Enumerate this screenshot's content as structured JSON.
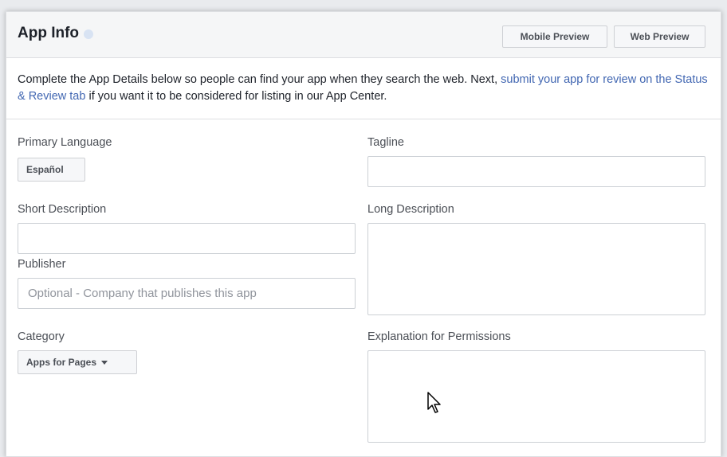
{
  "header": {
    "title": "App Info",
    "mobile_preview_label": "Mobile Preview",
    "web_preview_label": "Web Preview"
  },
  "intro": {
    "text_before": "Complete the App Details below so people can find your app when they search the web. Next, ",
    "link_text": "submit your app for review on the Status & Review tab",
    "text_after": " if you want it to be considered for listing in our App Center."
  },
  "form": {
    "primary_language": {
      "label": "Primary Language",
      "value": "Español"
    },
    "tagline": {
      "label": "Tagline",
      "value": ""
    },
    "short_description": {
      "label": "Short Description",
      "value": ""
    },
    "long_description": {
      "label": "Long Description",
      "value": ""
    },
    "publisher": {
      "label": "Publisher",
      "value": "",
      "placeholder": "Optional - Company that publishes this app"
    },
    "category": {
      "label": "Category",
      "value": "Apps for Pages"
    },
    "permissions_explanation": {
      "label": "Explanation for Permissions",
      "value": ""
    }
  },
  "colors": {
    "link": "#4267b2",
    "header_bg": "#f5f6f7",
    "border": "#dddfe2",
    "status_dot": "#d8e3f3"
  },
  "icons": {
    "status": "status-dot-icon",
    "dropdown": "caret-down-icon",
    "pointer": "mouse-pointer-icon"
  }
}
